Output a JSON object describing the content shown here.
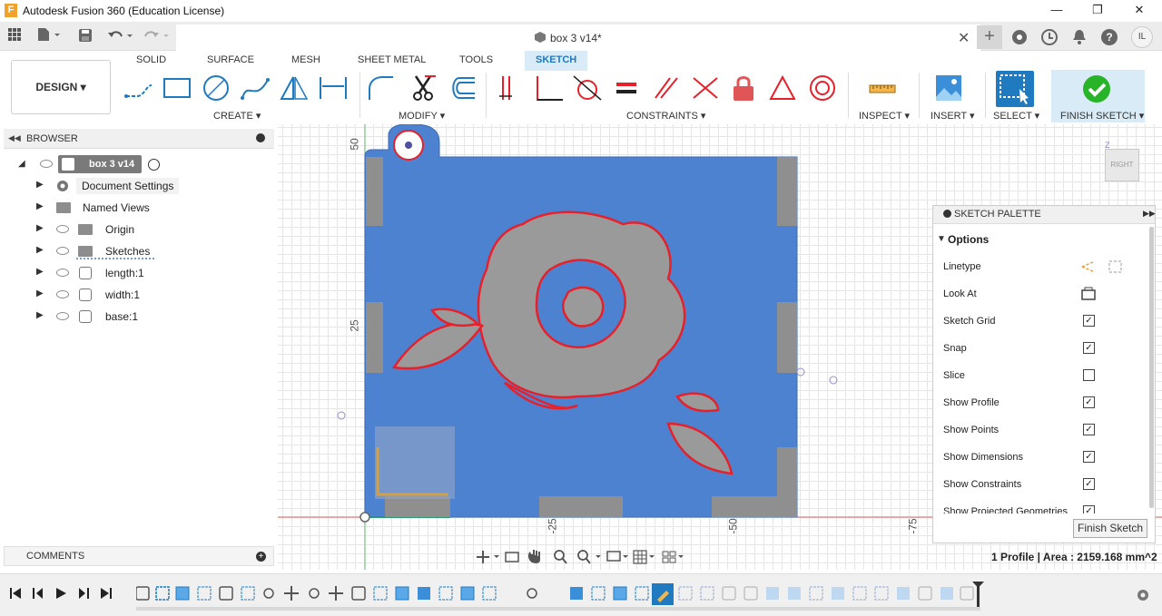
{
  "app": {
    "title": "Autodesk Fusion 360 (Education License)",
    "logo_letter": "F"
  },
  "window_controls": {
    "minimize": "—",
    "maximize": "❐",
    "close": "✕"
  },
  "document": {
    "tab_title": "box 3 v14*"
  },
  "user": {
    "initials": "IL"
  },
  "workspace": {
    "label": "DESIGN ▾"
  },
  "ribbon": {
    "tabs": [
      "SOLID",
      "SURFACE",
      "MESH",
      "SHEET METAL",
      "TOOLS",
      "SKETCH"
    ],
    "active_tab": "SKETCH",
    "groups": {
      "create": "CREATE ▾",
      "modify": "MODIFY ▾",
      "constraints": "CONSTRAINTS ▾",
      "inspect": "INSPECT ▾",
      "insert": "INSERT ▾",
      "select": "SELECT ▾",
      "finish": "FINISH SKETCH ▾"
    }
  },
  "browser": {
    "title": "BROWSER",
    "root": "box 3 v14",
    "items": [
      {
        "label": "Document Settings",
        "icon": "gear-icon"
      },
      {
        "label": "Named Views",
        "icon": "folder-icon"
      },
      {
        "label": "Origin",
        "icon": "folder-icon"
      },
      {
        "label": "Sketches",
        "icon": "folder-icon"
      },
      {
        "label": "length:1",
        "icon": "body-icon"
      },
      {
        "label": "width:1",
        "icon": "body-icon"
      },
      {
        "label": "base:1",
        "icon": "body-icon"
      }
    ]
  },
  "comments": {
    "title": "COMMENTS"
  },
  "axes": {
    "v50": "50",
    "v25": "25",
    "h25": "-25",
    "h50": "-50",
    "h75": "-75"
  },
  "viewcube": {
    "face": "RIGHT",
    "z": "Z"
  },
  "palette": {
    "title": "SKETCH PALETTE",
    "section": "Options",
    "rows": [
      {
        "label": "Linetype",
        "kind": "icons"
      },
      {
        "label": "Look At",
        "kind": "icon"
      },
      {
        "label": "Sketch Grid",
        "checked": true
      },
      {
        "label": "Snap",
        "checked": true
      },
      {
        "label": "Slice",
        "checked": false
      },
      {
        "label": "Show Profile",
        "checked": true
      },
      {
        "label": "Show Points",
        "checked": true
      },
      {
        "label": "Show Dimensions",
        "checked": true
      },
      {
        "label": "Show Constraints",
        "checked": true
      },
      {
        "label": "Show Projected Geometries",
        "checked": true
      }
    ],
    "finish_button": "Finish Sketch"
  },
  "status": {
    "text": "1 Profile | Area : 2159.168 mm^2"
  },
  "colors": {
    "accent": "#1f7ac0",
    "sketch_fill": "#4c82d0",
    "profile_line": "#e8202a",
    "finish_green": "#28b428",
    "gray_body": "#8f8f8f"
  }
}
